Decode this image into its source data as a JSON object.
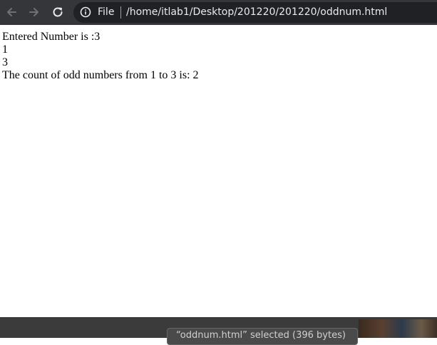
{
  "browser": {
    "scheme_label": "File",
    "url": "/home/itlab1/Desktop/201220/201220/oddnum.html"
  },
  "page": {
    "lines": [
      "Entered Number is :3",
      "1",
      "3",
      "The count of odd numbers from 1 to 3 is: 2"
    ]
  },
  "status": {
    "text": "“oddnum.html” selected  (396 bytes)"
  },
  "icons": {
    "back": "arrow-left-icon",
    "forward": "arrow-right-icon",
    "reload": "reload-icon",
    "info": "info-icon"
  },
  "colors": {
    "toolbar_bg": "#35363a",
    "omnibox_bg": "#202124",
    "page_bg": "#ffffff",
    "text": "#000000"
  }
}
